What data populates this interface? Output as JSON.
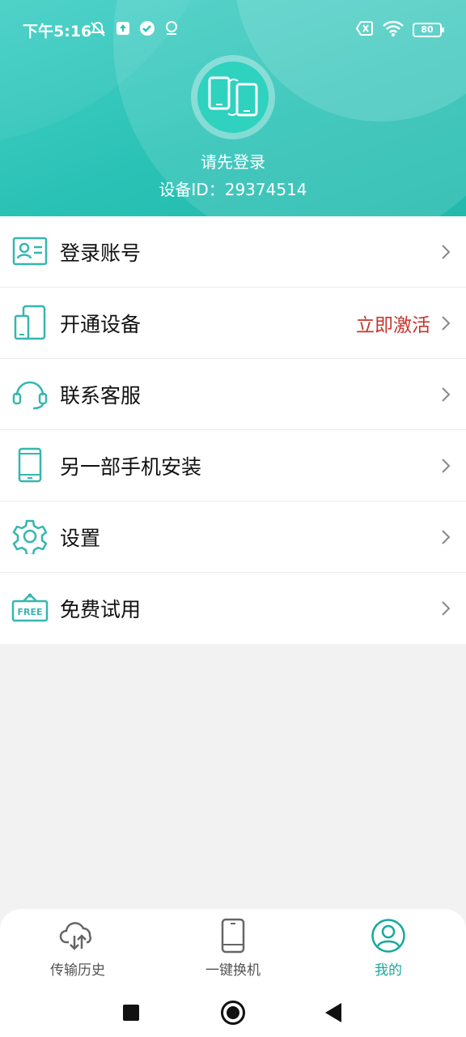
{
  "status_bar": {
    "time": "下午5:16",
    "battery": "80"
  },
  "profile": {
    "login_hint": "请先登录",
    "device_id": "设备ID：29374514"
  },
  "menu": [
    {
      "label": "登录账号",
      "icon": "id-card-icon"
    },
    {
      "label": "开通设备",
      "icon": "devices-icon",
      "extra": "立即激活"
    },
    {
      "label": "联系客服",
      "icon": "headset-icon"
    },
    {
      "label": "另一部手机安装",
      "icon": "phone-icon"
    },
    {
      "label": "设置",
      "icon": "gear-icon"
    },
    {
      "label": "免费试用",
      "icon": "free-sign-icon",
      "icon_text": "FREE"
    }
  ],
  "tabs": [
    {
      "label": "传输历史",
      "icon": "cloud-transfer-icon"
    },
    {
      "label": "一键换机",
      "icon": "phone-icon"
    },
    {
      "label": "我的",
      "icon": "user-icon",
      "active": true
    }
  ],
  "colors": {
    "accent": "#2bc2b6",
    "icon_teal": "#35b7ae",
    "activate_red": "#c6362d",
    "tab_active": "#16a99c"
  }
}
